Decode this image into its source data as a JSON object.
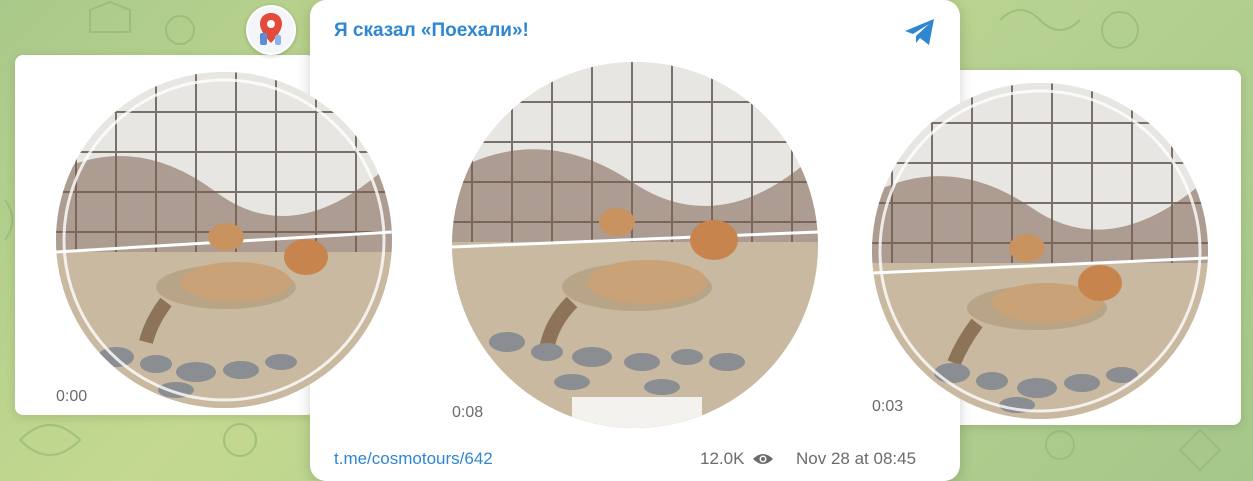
{
  "post": {
    "channel_title": "Я сказал «Поехали»!",
    "link": "t.me/cosmotours/642",
    "views": "12.0K",
    "date": "Nov 28 at 08:45"
  },
  "videos": [
    {
      "time": "0:00"
    },
    {
      "time": "0:08"
    },
    {
      "time": "0:03"
    }
  ],
  "icons": {
    "telegram": "telegram-icon",
    "views": "eye-icon",
    "avatar": "map-pin-avatar"
  },
  "colors": {
    "accent": "#2f87d1",
    "muted_text": "#6b6b6b",
    "background": "#b7d290"
  }
}
